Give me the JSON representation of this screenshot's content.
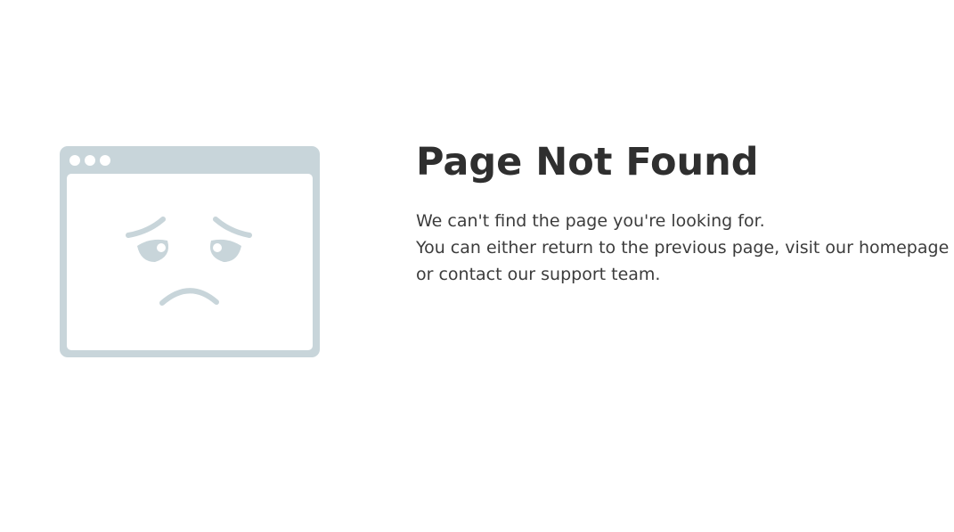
{
  "error_page": {
    "illustration_icon": "sad-browser-window-icon",
    "illustration_color": "#c8d5da",
    "title": "Page Not Found",
    "message_line_1": "We can't find the page you're looking for.",
    "message_line_2": "You can either return to the previous page, visit our homepage",
    "message_line_3": "or contact our support team."
  }
}
